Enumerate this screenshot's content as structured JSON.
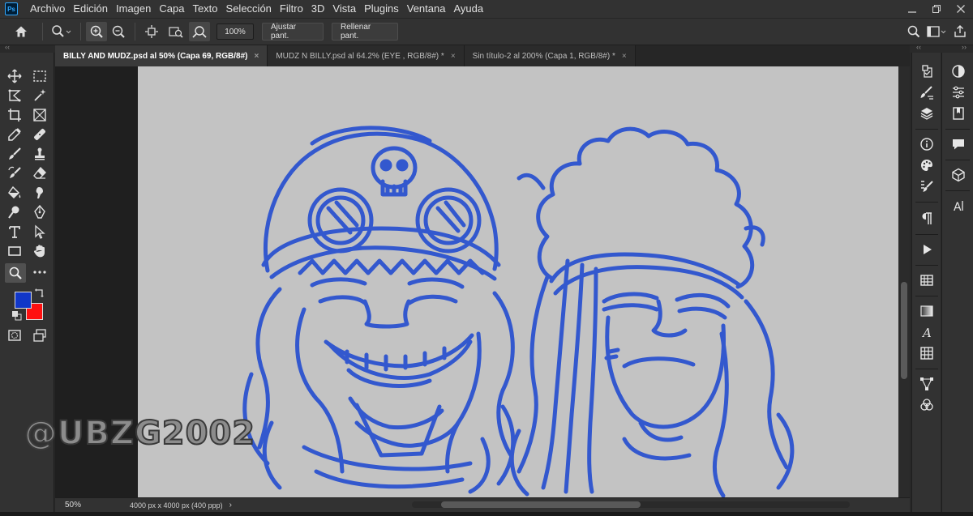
{
  "app": {
    "logo_text": "Ps"
  },
  "menu": [
    "Archivo",
    "Edición",
    "Imagen",
    "Capa",
    "Texto",
    "Selección",
    "Filtro",
    "3D",
    "Vista",
    "Plugins",
    "Ventana",
    "Ayuda"
  ],
  "options": {
    "zoom_value": "100%",
    "fit_label": "Ajustar pant.",
    "fill_label": "Rellenar pant."
  },
  "tabs": [
    {
      "label": "BILLY AND MUDZ.psd al 50% (Capa 69, RGB/8#)",
      "close": "×",
      "active": true
    },
    {
      "label": "MUDZ N BILLY.psd al 64.2% (EYE , RGB/8#) *",
      "close": "×",
      "active": false
    },
    {
      "label": "Sin título-2 al 200% (Capa 1, RGB/8#) *",
      "close": "×",
      "active": false
    }
  ],
  "status": {
    "zoom": "50%",
    "info": "4000 px x 4000 px (400 ppp)",
    "caret": "›"
  },
  "colors": {
    "foreground": "#1137c8",
    "background": "#ff1010",
    "sketch_stroke": "#1a46d0",
    "canvas": "#c3c3c3"
  },
  "watermark": "@UBZG2002",
  "icons": {
    "home": "home-icon",
    "zoom": "zoom-icon",
    "zoom_in": "zoom-in-icon",
    "zoom_out": "zoom-out-icon",
    "search": "search-icon",
    "workspace": "workspace-icon",
    "share": "share-icon"
  }
}
